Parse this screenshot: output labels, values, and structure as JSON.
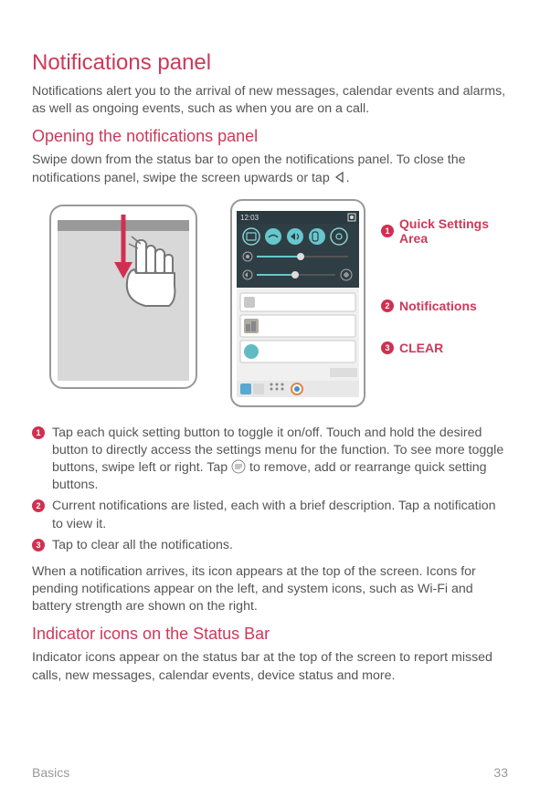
{
  "h1": "Notifications panel",
  "p1": "Notifications alert you to the arrival of new messages, calendar events and alarms, as well as ongoing events, such as when you are on a call.",
  "h2a": "Opening the notifications panel",
  "p2a": "Swipe down from the status bar to open the notifications panel. To close the notifications panel, swipe the screen upwards or tap ",
  "p2b": ".",
  "labels": {
    "l1": "Quick Settings Area",
    "l2": "Notifications",
    "l3": "CLEAR"
  },
  "n1a": "Tap each quick setting button to toggle it on/off. Touch and hold the desired button to directly access the settings menu for the function. To see more toggle buttons, swipe left or right. Tap ",
  "n1b": " to remove, add or rearrange quick setting buttons.",
  "n2": "Current notifications are listed, each with a brief description. Tap a notification to view it.",
  "n3": "Tap to clear all the notifications.",
  "p3": "When a notification arrives, its icon appears at the top of the screen. Icons for pending notifications appear on the left, and system icons, such as Wi-Fi and battery strength are shown on the right.",
  "h2b": "Indicator icons on the Status Bar",
  "p4": "Indicator icons appear on the status bar at the top of the screen to report missed calls, new messages, calendar events, device status and more.",
  "footer_left": "Basics",
  "footer_right": "33",
  "phone_time": "12:03"
}
